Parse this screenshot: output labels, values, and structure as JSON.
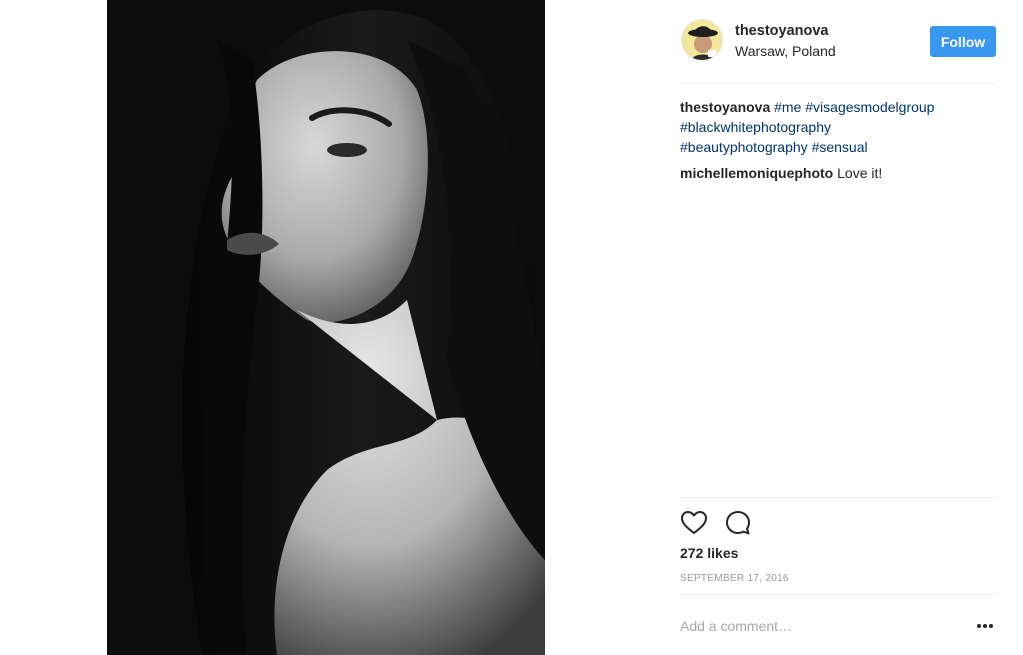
{
  "post": {
    "username": "thestoyanova",
    "location": "Warsaw, Poland",
    "follow_label": "Follow",
    "photo_icon": "portrait-photo",
    "avatar_icon": "avatar-photo"
  },
  "caption": {
    "username": "thestoyanova",
    "hashtags": [
      "#me",
      "#visagesmodelgroup",
      "#blackwhitephotography",
      "#beautyphotography",
      "#sensual"
    ]
  },
  "comments": [
    {
      "username": "michellemoniquephoto",
      "text": "Love it!"
    }
  ],
  "actions": {
    "like_icon": "heart-icon",
    "comment_icon": "comment-bubble-icon",
    "more_icon": "ellipsis-icon"
  },
  "likes": "272 likes",
  "date": "SEPTEMBER 17, 2016",
  "comment_box": {
    "placeholder": "Add a comment…"
  },
  "colors": {
    "follow_button": "#3897f0",
    "hashtag": "#003569",
    "date": "#999999"
  }
}
